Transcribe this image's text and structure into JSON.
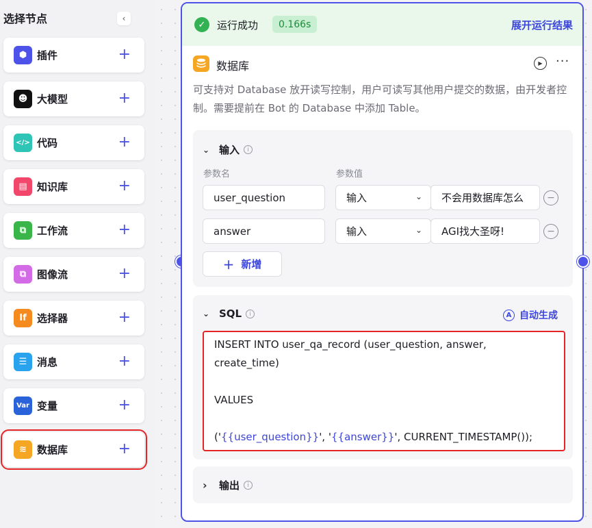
{
  "sidebar": {
    "title": "选择节点",
    "collapse_icon": "‹",
    "items": [
      {
        "label": "插件",
        "icon": "plugin-cube-icon",
        "color": "#4d53e8",
        "glyph": "⬢",
        "selected": false
      },
      {
        "label": "大模型",
        "icon": "llm-bot-icon",
        "color": "#111111",
        "glyph": "☻",
        "selected": false
      },
      {
        "label": "代码",
        "icon": "code-icon",
        "color": "#2ec4b6",
        "glyph": "</>",
        "selected": false
      },
      {
        "label": "知识库",
        "icon": "knowledge-icon",
        "color": "#f2466a",
        "glyph": "▤",
        "selected": false
      },
      {
        "label": "工作流",
        "icon": "workflow-icon",
        "color": "#3ab54a",
        "glyph": "⧉",
        "selected": false
      },
      {
        "label": "图像流",
        "icon": "image-flow-icon",
        "color": "#d46be6",
        "glyph": "⧉",
        "selected": false
      },
      {
        "label": "选择器",
        "icon": "selector-if-icon",
        "color": "#f58a1f",
        "glyph": "If",
        "selected": false
      },
      {
        "label": "消息",
        "icon": "message-icon",
        "color": "#2aa3ef",
        "glyph": "☰",
        "selected": false
      },
      {
        "label": "变量",
        "icon": "variable-icon",
        "color": "#2962d9",
        "glyph": "Var",
        "selected": false
      },
      {
        "label": "数据库",
        "icon": "database-icon",
        "color": "#f5a623",
        "glyph": "≋",
        "selected": true
      }
    ],
    "plus_glyph": "+"
  },
  "node": {
    "status_text": "运行成功",
    "status_glyph": "✓",
    "time": "0.166s",
    "expand_label": "展开运行结果",
    "title": "数据库",
    "title_glyph": "≋",
    "run_glyph": "▶",
    "more_glyph": "···",
    "description": "可支持对 Database 放开读写控制，用户可读写其他用户提交的数据，由开发者控制。需要提前在 Bot 的 Database 中添加 Table。",
    "input": {
      "label": "输入",
      "col_name": "参数名",
      "col_value": "参数值",
      "rows": [
        {
          "name": "user_question",
          "type": "输入",
          "value": "不会用数据库怎么"
        },
        {
          "name": "answer",
          "type": "输入",
          "value": "AGI找大圣呀!"
        }
      ],
      "add_label": "新增",
      "add_glyph": "+",
      "minus_glyph": "−",
      "caret_glyph": "⌄"
    },
    "sql": {
      "label": "SQL",
      "auto_label": "自动生成",
      "auto_glyph": "A",
      "line1": "INSERT INTO user_qa_record (user_question, answer,",
      "line2": "create_time)",
      "line3": "",
      "line4": "VALUES",
      "line5": "",
      "line6_a": "('",
      "line6_var1": "{{user_question}}",
      "line6_b": "', '",
      "line6_var2": "{{answer}}",
      "line6_c": "', CURRENT_TIMESTAMP());"
    },
    "output": {
      "label": "输出"
    },
    "chevron_down": "⌄",
    "chevron_right": "›",
    "info_glyph": "i"
  },
  "colors": {
    "accent": "#4d53e8",
    "success": "#32b253",
    "highlight": "#e52525"
  }
}
